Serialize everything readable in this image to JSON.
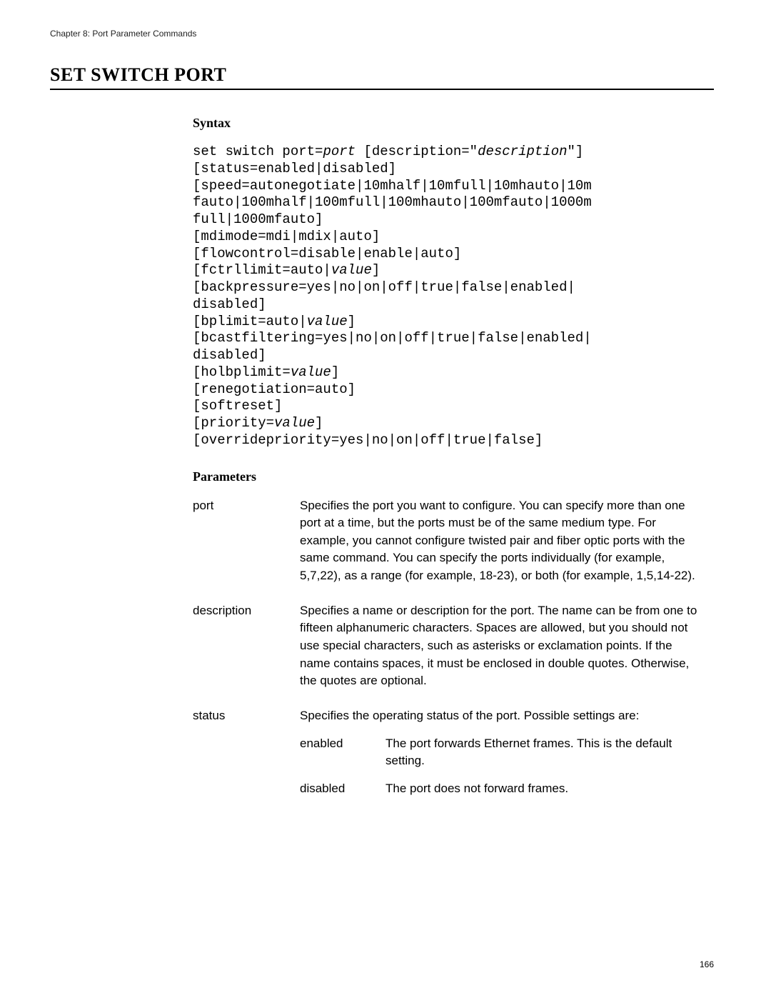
{
  "chapter_header": "Chapter 8: Port Parameter Commands",
  "title": "SET SWITCH PORT",
  "syntax_heading": "Syntax",
  "syntax_lines": [
    {
      "plain": "set switch port=",
      "ital": "port",
      "plain2": " [description=\"",
      "ital2": "description",
      "plain3": "\"]"
    },
    {
      "plain": "[status=enabled|disabled]"
    },
    {
      "plain": "[speed=autonegotiate|10mhalf|10mfull|10mhauto|10m"
    },
    {
      "plain": "fauto|100mhalf|100mfull|100mhauto|100mfauto|1000m"
    },
    {
      "plain": "full|1000mfauto]"
    },
    {
      "plain": "[mdimode=mdi|mdix|auto]"
    },
    {
      "plain": "[flowcontrol=disable|enable|auto]"
    },
    {
      "plain": "[fctrllimit=auto|",
      "ital": "value",
      "plain2": "]"
    },
    {
      "plain": "[backpressure=yes|no|on|off|true|false|enabled|"
    },
    {
      "plain": "disabled]"
    },
    {
      "plain": "[bplimit=auto|",
      "ital": "value",
      "plain2": "]"
    },
    {
      "plain": "[bcastfiltering=yes|no|on|off|true|false|enabled|"
    },
    {
      "plain": "disabled]"
    },
    {
      "plain": "[holbplimit=",
      "ital": "value",
      "plain2": "]"
    },
    {
      "plain": "[renegotiation=auto]"
    },
    {
      "plain": "[softreset]"
    },
    {
      "plain": "[priority=",
      "ital": "value",
      "plain2": "]"
    },
    {
      "plain": "[overridepriority=yes|no|on|off|true|false]"
    }
  ],
  "parameters_heading": "Parameters",
  "params": [
    {
      "name": "port",
      "desc": "Specifies the port you want to configure. You can specify more than one port at a time, but the ports must be of the same medium type. For example, you cannot configure twisted pair and fiber optic ports with the same command. You can specify the ports individually (for example, 5,7,22), as a range (for example, 18-23), or both (for example, 1,5,14-22)."
    },
    {
      "name": "description",
      "desc": "Specifies a name or description for the port. The name can be from one to fifteen alphanumeric characters. Spaces are allowed, but you should not use special characters, such as asterisks or exclamation points. If the name contains spaces, it must be enclosed in double quotes. Otherwise, the quotes are optional."
    },
    {
      "name": "status",
      "desc": "Specifies the operating status of the port. Possible settings are:",
      "sub": [
        {
          "name": "enabled",
          "desc": "The port forwards Ethernet frames. This is the default setting."
        },
        {
          "name": "disabled",
          "desc": "The port does not forward frames."
        }
      ]
    }
  ],
  "page_number": "166"
}
